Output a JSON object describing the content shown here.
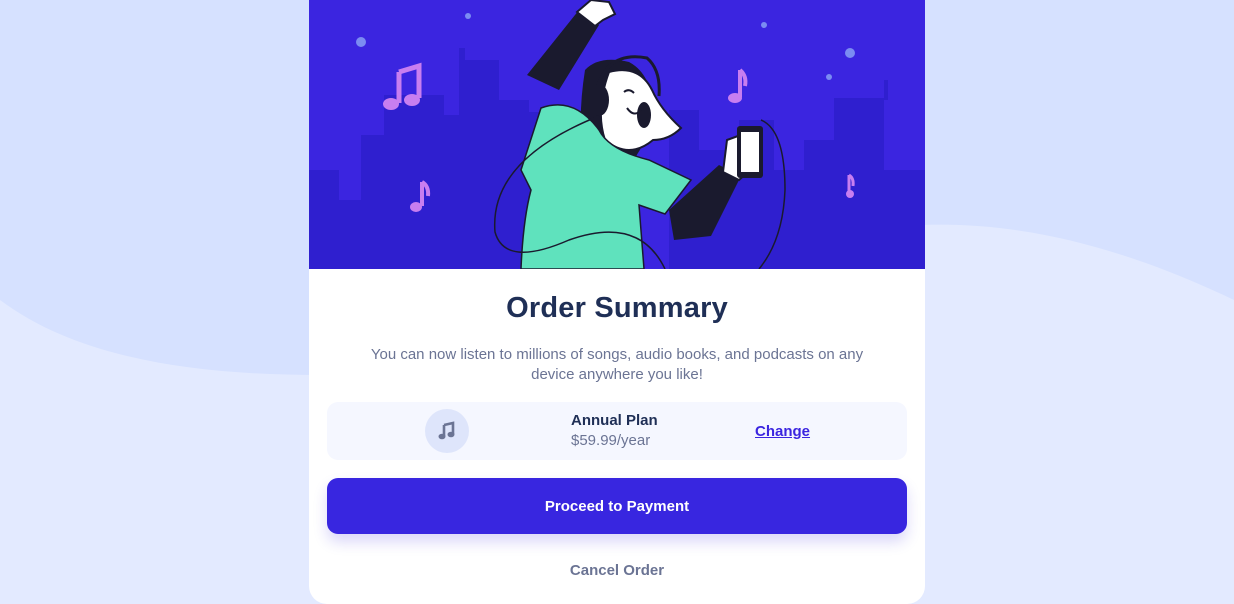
{
  "colors": {
    "page_background": "#d6e1ff",
    "wave": "#e3eaff",
    "hero_background": "#3b25e0",
    "city": "#2f1fcf",
    "accent": "#3826e0",
    "heading": "#1f2f56",
    "muted_text": "#6b7494",
    "shirt": "#5fe2bd",
    "note": "#c87ef0"
  },
  "hero": {
    "illustration": "person-dancing-with-headphones-illustration"
  },
  "summary": {
    "title": "Order Summary",
    "description": "You can now listen to millions of songs, audio books, and podcasts on any device anywhere you like!"
  },
  "plan": {
    "icon": "music-note-icon",
    "name": "Annual Plan",
    "price": "$59.99/year",
    "change_label": "Change"
  },
  "actions": {
    "proceed_label": "Proceed to Payment",
    "cancel_label": "Cancel Order"
  }
}
